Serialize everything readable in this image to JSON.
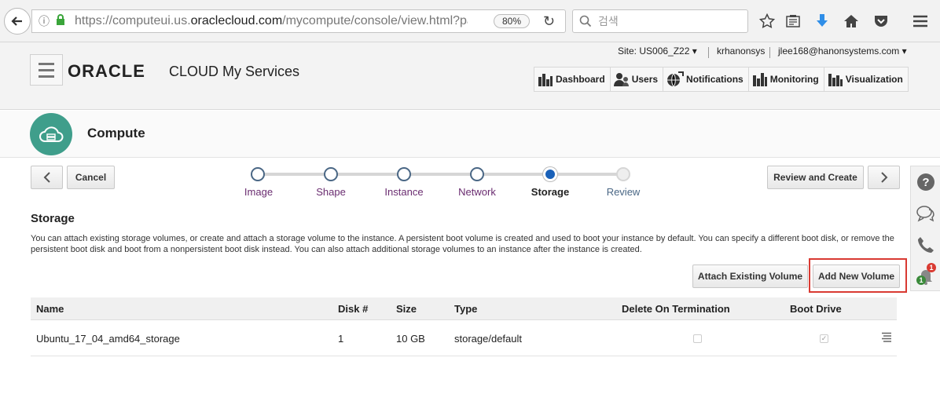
{
  "browser": {
    "url_prefix": "https://computeui.us.",
    "url_domain": "oraclecloud.com",
    "url_suffix": "/mycompute/console/view.html?page",
    "zoom": "80%",
    "search_placeholder": "검색"
  },
  "header": {
    "logo": "ORACLE",
    "product": "CLOUD My Services",
    "site": "Site: US006_Z22",
    "account": "krhanonsys",
    "user": "jlee168@hanonsystems.com",
    "nav": [
      {
        "label": "Dashboard",
        "icon": "dashboard-icon"
      },
      {
        "label": "Users",
        "icon": "users-icon"
      },
      {
        "label": "Notifications",
        "icon": "notifications-globe-icon"
      },
      {
        "label": "Monitoring",
        "icon": "monitoring-icon"
      },
      {
        "label": "Visualization",
        "icon": "visualization-icon"
      }
    ]
  },
  "compute": {
    "title": "Compute"
  },
  "wizard": {
    "cancel": "Cancel",
    "review_create": "Review and Create",
    "steps": [
      {
        "label": "Image",
        "state": "done"
      },
      {
        "label": "Shape",
        "state": "done"
      },
      {
        "label": "Instance",
        "state": "done"
      },
      {
        "label": "Network",
        "state": "done"
      },
      {
        "label": "Storage",
        "state": "current"
      },
      {
        "label": "Review",
        "state": "disabled"
      }
    ]
  },
  "storage": {
    "title": "Storage",
    "description": "You can attach existing storage volumes, or create and attach a storage volume to the instance. A persistent boot volume is created and used to boot your instance by default. You can specify a different boot disk, or remove the persistent boot disk and boot from a nonpersistent boot disk instead. You can also attach additional storage volumes to an instance after the instance is created.",
    "attach_existing": "Attach Existing Volume",
    "add_new": "Add New Volume",
    "columns": [
      "Name",
      "Disk #",
      "Size",
      "Type",
      "Delete On Termination",
      "Boot Drive"
    ],
    "rows": [
      {
        "name": "Ubuntu_17_04_amd64_storage",
        "disk": "1",
        "size": "10 GB",
        "type": "storage/default",
        "delete_on_termination": false,
        "boot_drive": true
      }
    ]
  },
  "side_tools": {
    "notification_count": "1",
    "badge_count": "1"
  },
  "colors": {
    "compute_teal": "#3f9e8b",
    "train_current": "#1a61b9",
    "highlight_red": "#d93a32",
    "download_blue": "#2f8ee8"
  }
}
